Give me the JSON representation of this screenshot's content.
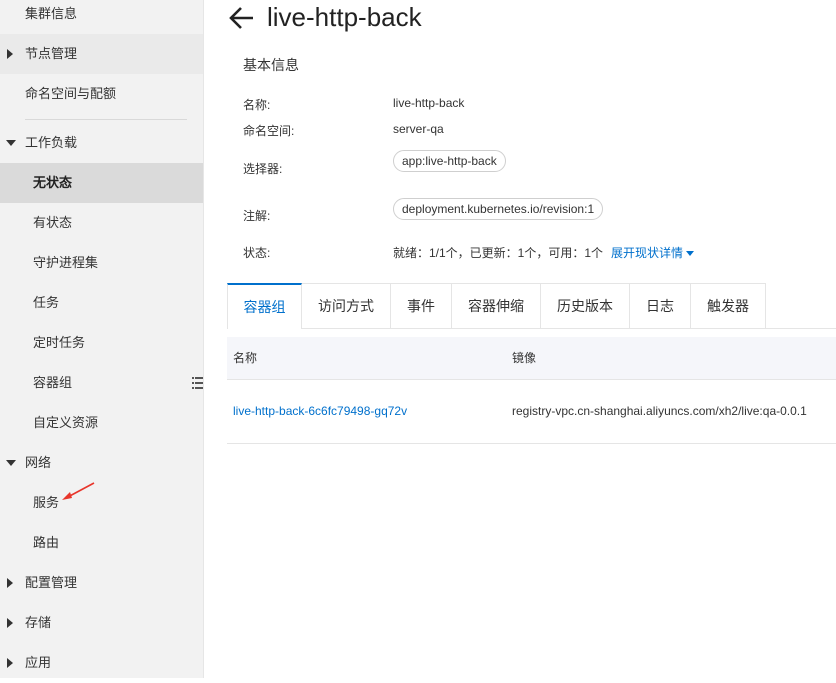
{
  "sidebar": {
    "items": [
      {
        "label": "集群信息"
      },
      {
        "label": "节点管理"
      },
      {
        "label": "命名空间与配额"
      },
      {
        "label": "工作负载"
      },
      {
        "label": "无状态"
      },
      {
        "label": "有状态"
      },
      {
        "label": "守护进程集"
      },
      {
        "label": "任务"
      },
      {
        "label": "定时任务"
      },
      {
        "label": "容器组"
      },
      {
        "label": "自定义资源"
      },
      {
        "label": "网络"
      },
      {
        "label": "服务"
      },
      {
        "label": "路由"
      },
      {
        "label": "配置管理"
      },
      {
        "label": "存储"
      },
      {
        "label": "应用"
      }
    ]
  },
  "header": {
    "title": "live-http-back"
  },
  "basic_info": {
    "section_title": "基本信息",
    "name_label": "名称:",
    "name_value": "live-http-back",
    "namespace_label": "命名空间:",
    "namespace_value": "server-qa",
    "selector_label": "选择器:",
    "selector_value": "app:live-http-back",
    "annotation_label": "注解:",
    "annotation_value": "deployment.kubernetes.io/revision:1",
    "status_label": "状态:",
    "status_value": "就绪：1/1个，已更新：1个，可用：1个",
    "status_link": "展开现状详情"
  },
  "tabs": [
    {
      "label": "容器组"
    },
    {
      "label": "访问方式"
    },
    {
      "label": "事件"
    },
    {
      "label": "容器伸缩"
    },
    {
      "label": "历史版本"
    },
    {
      "label": "日志"
    },
    {
      "label": "触发器"
    }
  ],
  "table": {
    "columns": [
      "名称",
      "镜像"
    ],
    "rows": [
      {
        "name": "live-http-back-6c6fc79498-gq72v",
        "image": "registry-vpc.cn-shanghai.aliyuncs.com/xh2/live:qa-0.0.1"
      }
    ]
  },
  "colors": {
    "accent": "#0070cc",
    "sidebar_bg": "#f2f2f2",
    "annotation_arrow": "#e8352b"
  }
}
